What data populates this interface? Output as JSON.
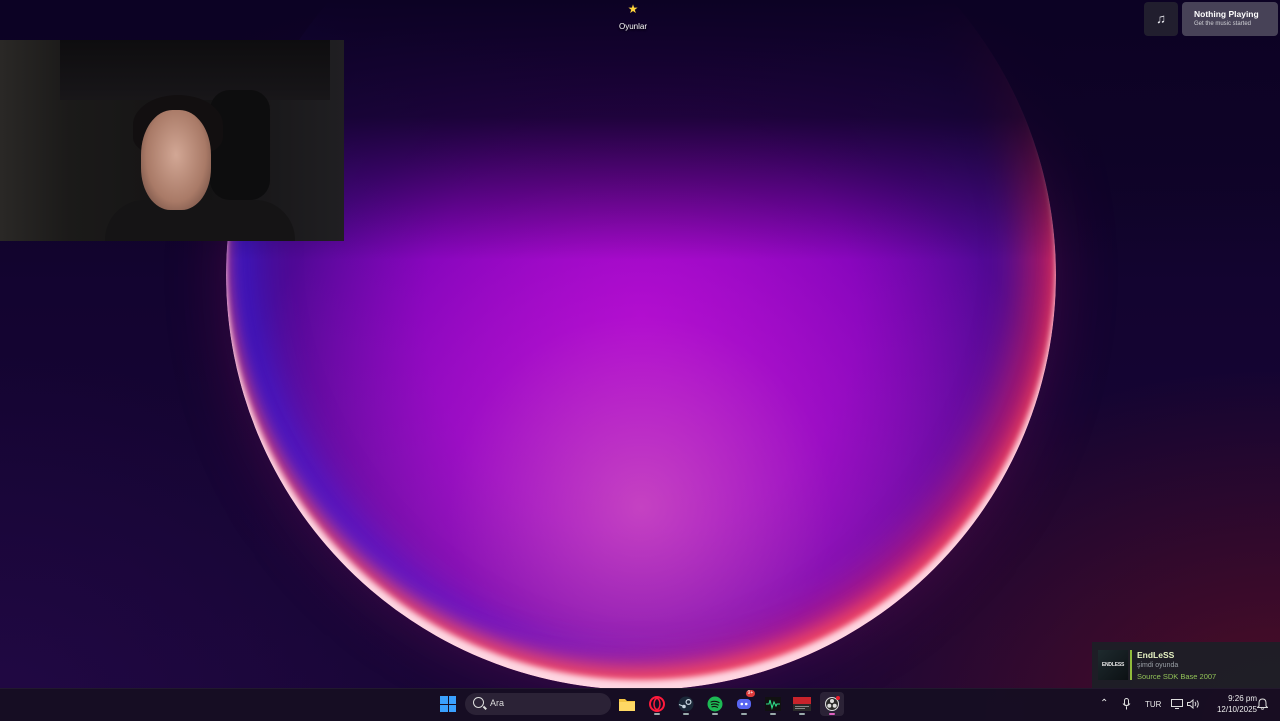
{
  "desktop": {
    "icons": [
      {
        "label": "Oyunlar",
        "icon": "star-icon"
      }
    ]
  },
  "music_widget": {
    "icon": "music-note-icon",
    "title": "Nothing Playing",
    "subtitle": "Get the music started"
  },
  "game_toast": {
    "art_text": "ENDLESS",
    "name": "EndLeSS",
    "status": "şimdi oyunda",
    "game": "Source SDK Base 2007"
  },
  "taskbar": {
    "search_placeholder": "Ara",
    "apps": [
      {
        "name": "file-explorer",
        "icon": "folder-icon"
      },
      {
        "name": "opera-gx",
        "icon": "opera-icon"
      },
      {
        "name": "steam",
        "icon": "steam-icon"
      },
      {
        "name": "spotify",
        "icon": "spotify-icon"
      },
      {
        "name": "discord",
        "icon": "discord-icon",
        "badge": "9+"
      },
      {
        "name": "audio-monitor",
        "icon": "waveform-icon"
      },
      {
        "name": "voice-app",
        "icon": "voice-icon"
      },
      {
        "name": "obs",
        "icon": "record-icon"
      }
    ],
    "tray": {
      "language": "TUR",
      "time": "9:26 pm",
      "date": "12/10/2025"
    }
  },
  "colors": {
    "accent_windows": "#3aa0ff",
    "steam_green": "#91c257",
    "spotify": "#1db954"
  }
}
